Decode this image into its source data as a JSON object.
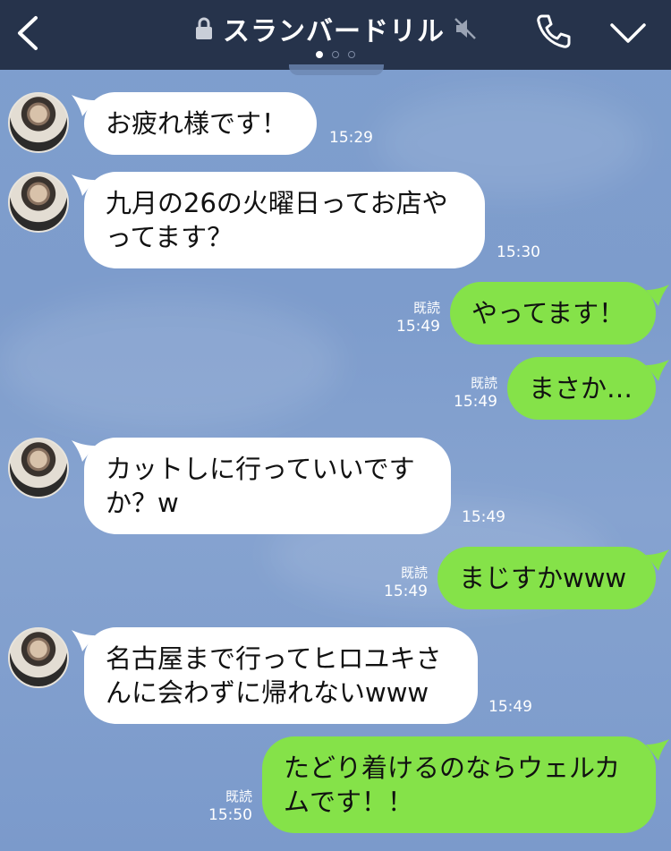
{
  "header": {
    "title": "スランバードリル",
    "back_icon": "chevron-left-icon",
    "lock_icon": "lock-icon",
    "mute_icon": "speaker-muted-icon",
    "call_icon": "phone-icon",
    "menu_icon": "chevron-down-icon",
    "page_dots": 3,
    "active_dot": 0
  },
  "colors": {
    "header_bg": "#26334b",
    "chat_bg": "#7f9fce",
    "bubble_in": "#ffffff",
    "bubble_out": "#85e249"
  },
  "messages": [
    {
      "side": "in",
      "text": "お疲れ様です！",
      "time": "15:29"
    },
    {
      "side": "in",
      "text": "九月の26の火曜日ってお店や\nってます？",
      "time": "15:30"
    },
    {
      "side": "out",
      "text": "やってます！",
      "read": "既読",
      "time": "15:49"
    },
    {
      "side": "out",
      "text": "まさか…",
      "read": "既読",
      "time": "15:49"
    },
    {
      "side": "in",
      "text": "カットしに行っていいです\nか？w",
      "time": "15:49"
    },
    {
      "side": "out",
      "text": "まじすかwww",
      "read": "既読",
      "time": "15:49"
    },
    {
      "side": "in",
      "text": "名古屋まで行ってヒロユキさ\nんに会わずに帰れないwww",
      "time": "15:49"
    },
    {
      "side": "out",
      "text": "たどり着けるのならウェルカ\nムです！！",
      "read": "既読",
      "time": "15:50"
    }
  ]
}
